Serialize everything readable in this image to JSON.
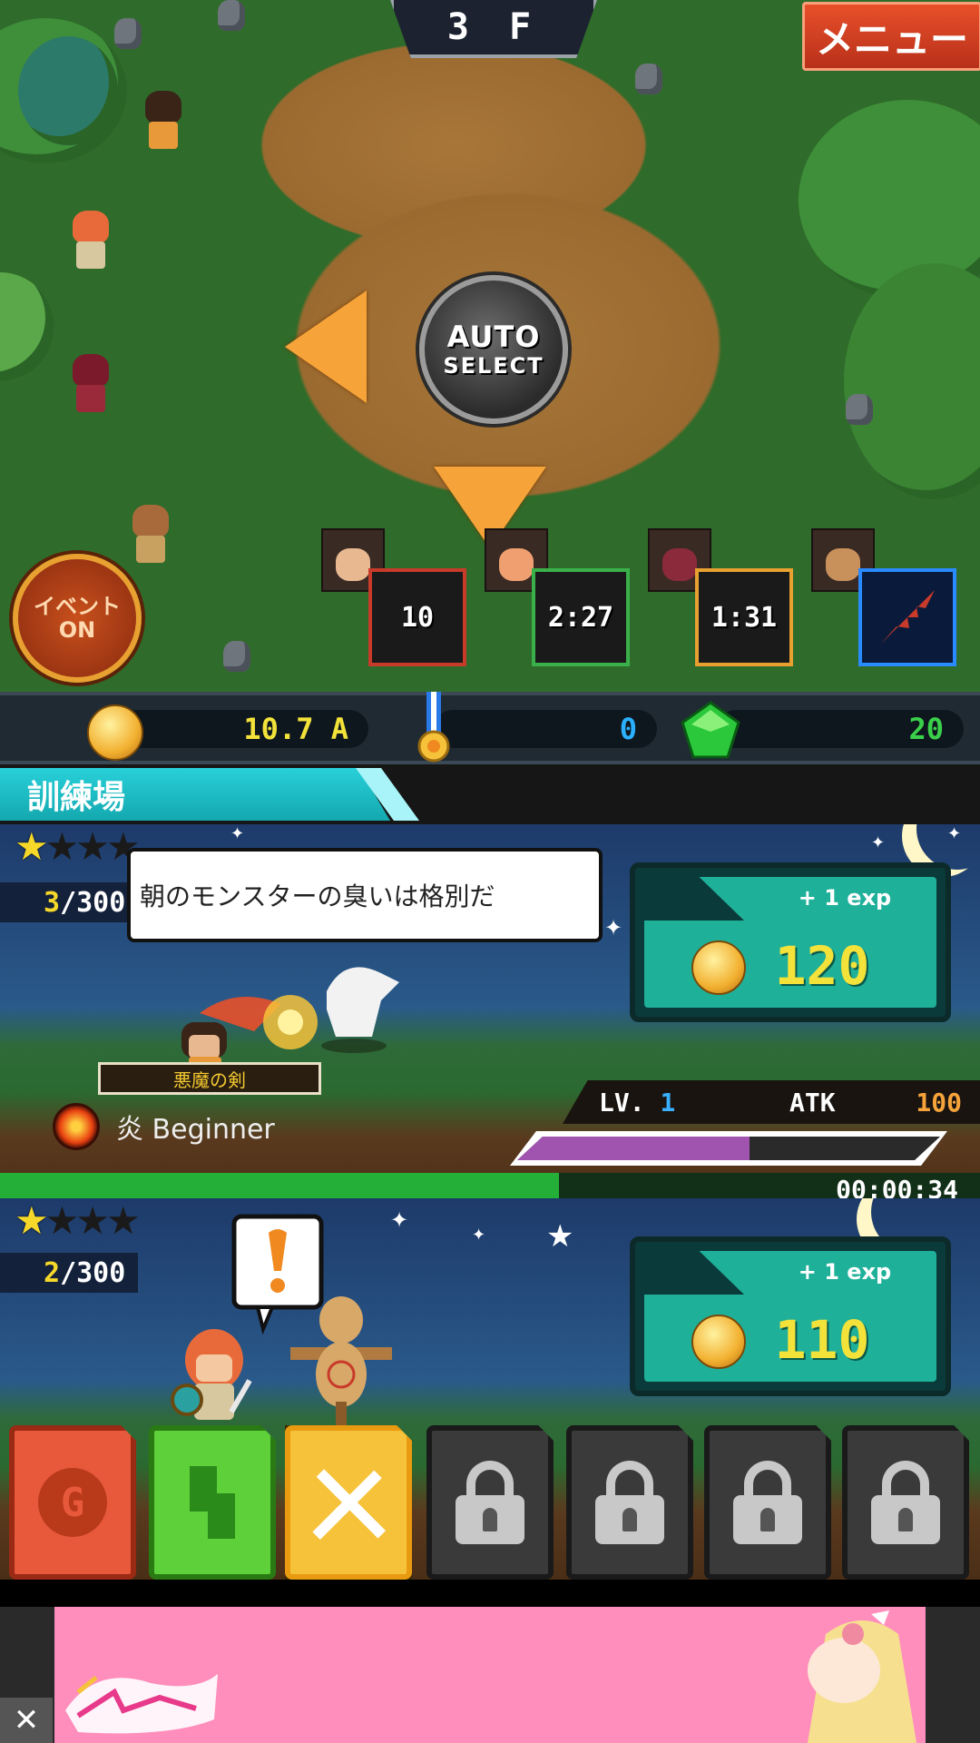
{
  "hud": {
    "floor": "3 F",
    "menu_label": "メニュー",
    "auto_line1": "AUTO",
    "auto_line2": "SELECT",
    "event_line1": "イベント",
    "event_line2": "ON",
    "skill_timers": [
      "10",
      "2:27",
      "1:31"
    ]
  },
  "currency": {
    "gold": "10.7 A",
    "medals": "0",
    "gems": "20"
  },
  "section": {
    "title": "訓練場"
  },
  "training": [
    {
      "stars": 1,
      "max_stars": 4,
      "count": "3",
      "count_max": "/300",
      "speech": "朝のモンスターの臭いは格別だ",
      "exp": "+ 1 exp",
      "reward": "120",
      "weapon": "悪魔の剣",
      "rank": "炎 Beginner",
      "level_label": "LV.",
      "level": "1",
      "atk_label": "ATK",
      "atk": "100",
      "xp_fraction": 0.55,
      "timer_fraction": 0.57,
      "timer": "00:00:34"
    },
    {
      "stars": 1,
      "max_stars": 4,
      "count": "2",
      "count_max": "/300",
      "exp": "+ 1 exp",
      "reward": "110"
    }
  ],
  "tabs": [
    {
      "name": "gold-tab",
      "symbol": "G",
      "color": "#e8583a",
      "locked": false
    },
    {
      "name": "green-tab",
      "symbol": "S",
      "color": "#5ed03a",
      "locked": false
    },
    {
      "name": "battle-tab",
      "symbol": "✕",
      "color": "#f6c23a",
      "locked": false
    },
    {
      "name": "locked-tab-1",
      "locked": true
    },
    {
      "name": "locked-tab-2",
      "locked": true
    },
    {
      "name": "locked-tab-3",
      "locked": true
    },
    {
      "name": "locked-tab-4",
      "locked": true
    }
  ],
  "ad": {
    "close_symbol": "✕"
  },
  "colors": {
    "accent_cyan": "#1fc0c8",
    "gold_text": "#f2e23a",
    "gem_text": "#3ad04a",
    "medal_text": "#2ab0ff"
  }
}
